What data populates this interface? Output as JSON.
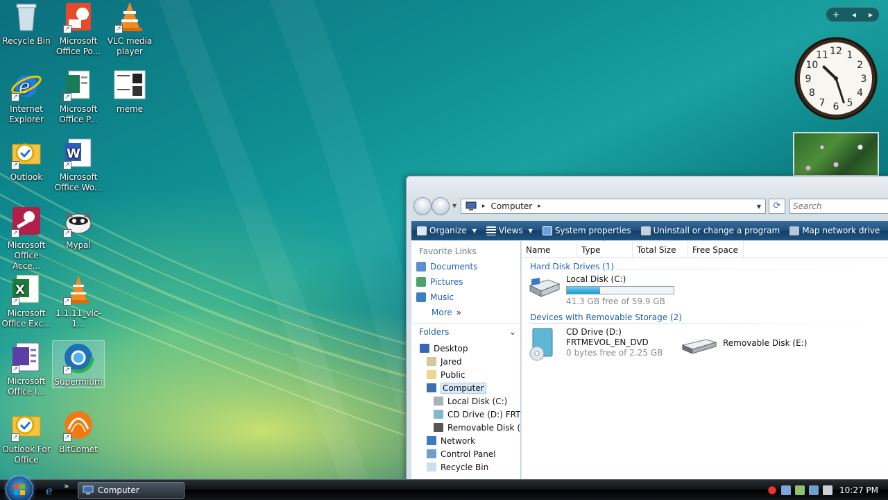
{
  "desktop": {
    "icons": [
      {
        "label": "Recycle Bin",
        "icon": "recycle-bin-icon"
      },
      {
        "label": "Microsoft Office Po...",
        "icon": "powerpoint-icon"
      },
      {
        "label": "VLC media player",
        "icon": "vlc-icon"
      },
      {
        "label": "Internet Explorer",
        "icon": "internet-explorer-icon"
      },
      {
        "label": "Microsoft Office P...",
        "icon": "publisher-icon"
      },
      {
        "label": "meme",
        "icon": "image-file-icon"
      },
      {
        "label": "Outlook",
        "icon": "outlook-icon"
      },
      {
        "label": "Microsoft Office Wo...",
        "icon": "word-icon"
      },
      {
        "label": "Microsoft Office Acce...",
        "icon": "access-icon"
      },
      {
        "label": "Mypal",
        "icon": "mypal-icon"
      },
      {
        "label": "Microsoft Office Exc...",
        "icon": "excel-icon"
      },
      {
        "label": "1.1.11_vlc-1...",
        "icon": "vlc-installer-icon"
      },
      {
        "label": "Microsoft Office I...",
        "icon": "infopath-icon"
      },
      {
        "label": "Supermium",
        "icon": "supermium-icon"
      },
      {
        "label": "Outlook For Office",
        "icon": "outlook-for-office-icon"
      },
      {
        "label": "BitComet",
        "icon": "bitcomet-icon"
      }
    ]
  },
  "gadgets": {
    "toolbar_add": "+",
    "toolbar_prev": "◂",
    "toolbar_next": "▸",
    "clock": {
      "hour": 10,
      "minute": 27,
      "numerals": [
        "12",
        "1",
        "2",
        "3",
        "4",
        "5",
        "6",
        "7",
        "8",
        "9",
        "10",
        "11"
      ]
    }
  },
  "explorer": {
    "address": {
      "root_arrow": "▸",
      "location": "Computer",
      "trail_arrow": "▸"
    },
    "search_placeholder": "Search",
    "toolbar": {
      "organize": "Organize",
      "views": "Views",
      "system_properties": "System properties",
      "uninstall": "Uninstall or change a program",
      "map_drive": "Map network drive",
      "more": "»"
    },
    "favorite_links_title": "Favorite Links",
    "favorite_links": [
      "Documents",
      "Pictures",
      "Music"
    ],
    "more_label": "More",
    "more_arrow": "»",
    "folders_title": "Folders",
    "folders_caret": "⌄",
    "tree": [
      {
        "label": "Desktop",
        "indent": 0
      },
      {
        "label": "Jared",
        "indent": 1
      },
      {
        "label": "Public",
        "indent": 1
      },
      {
        "label": "Computer",
        "indent": 1,
        "selected": true
      },
      {
        "label": "Local Disk (C:)",
        "indent": 2
      },
      {
        "label": "CD Drive (D:) FRTI",
        "indent": 2
      },
      {
        "label": "Removable Disk (E",
        "indent": 2
      },
      {
        "label": "Network",
        "indent": 1
      },
      {
        "label": "Control Panel",
        "indent": 1
      },
      {
        "label": "Recycle Bin",
        "indent": 1
      }
    ],
    "columns": [
      "Name",
      "Type",
      "Total Size",
      "Free Space"
    ],
    "groups": {
      "hard_disks": "Hard Disk Drives (1)",
      "removable": "Devices with Removable Storage (2)"
    },
    "drives": {
      "c": {
        "name": "Local Disk (C:)",
        "free_text": "41.3 GB free of 59.9 GB",
        "used_fraction": 0.31
      },
      "d": {
        "name": "CD Drive (D:)",
        "volume": "FRTMEVOL_EN_DVD",
        "free_text": "0 bytes free of 2.25 GB"
      },
      "e": {
        "name": "Removable Disk (E:)"
      }
    }
  },
  "taskbar": {
    "task_label": "Computer",
    "quicklaunch_more": "»",
    "clock": "10:27 PM"
  },
  "colors": {
    "accent": "#1e5fae",
    "toolbar": "#1e4f7d"
  }
}
